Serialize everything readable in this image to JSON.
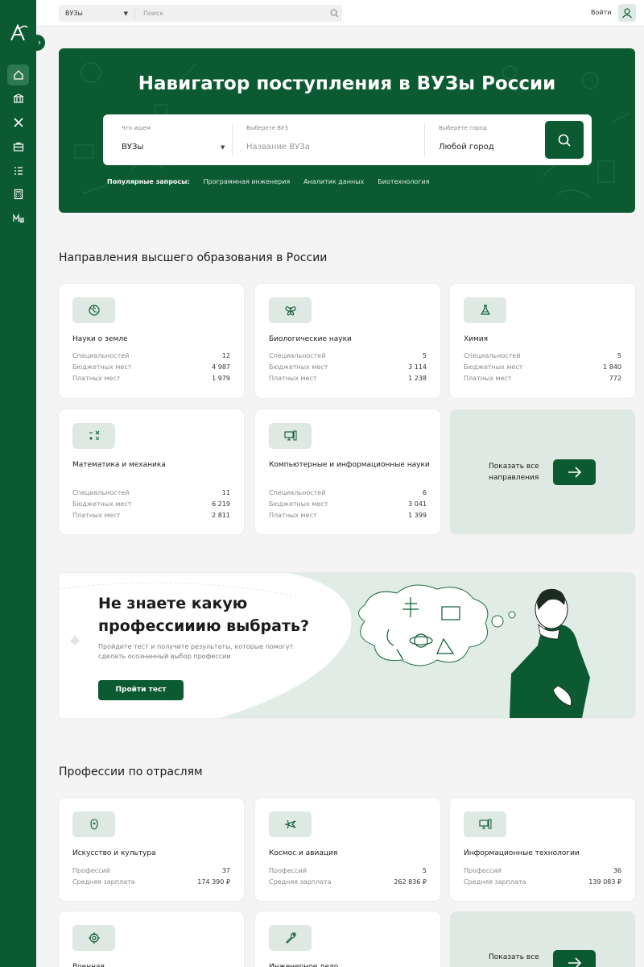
{
  "topbar": {
    "search_select": "ВУЗы",
    "search_placeholder": "Поиск",
    "login": "Войти"
  },
  "hero": {
    "title": "Навигатор поступления в ВУЗы России",
    "what_label": "Что ищем",
    "what_value": "ВУЗы",
    "vuz_label": "Выберете ВУЗ",
    "vuz_placeholder": "Название ВУЗа",
    "city_label": "Выберете город",
    "city_value": "Любой город",
    "popular_label": "Популярные запросы:",
    "popular_items": [
      "Программная инженерия",
      "Аналитик данных",
      "Биотехнология"
    ]
  },
  "directions": {
    "title": "Направления высшего образования в России",
    "stat_labels": [
      "Специальностей",
      "Бюджетных мест",
      "Платных мест"
    ],
    "cards": [
      {
        "name": "Науки о земле",
        "icon": "globe-icon",
        "values": [
          "12",
          "4 987",
          "1 979"
        ]
      },
      {
        "name": "Биологические науки",
        "icon": "butterfly-icon",
        "values": [
          "5",
          "3 114",
          "1 238"
        ]
      },
      {
        "name": "Химия",
        "icon": "flask-icon",
        "values": [
          "5",
          "1 840",
          "772"
        ]
      },
      {
        "name": "Математика и механика",
        "icon": "math-icon",
        "values": [
          "11",
          "6 219",
          "2 811"
        ]
      },
      {
        "name": "Компьютерные и информационные науки",
        "icon": "computer-icon",
        "values": [
          "6",
          "3 041",
          "1 399"
        ]
      }
    ],
    "show_all": "Показать все направления"
  },
  "banner": {
    "title": "Не знаете какую профессииию выбрать?",
    "text": "Пройдите тест и получите результаты, которые помогут сделать осознанный выбор профессии",
    "button": "Пройти тест"
  },
  "professions": {
    "title": "Профессии по отраслям",
    "stat_labels": [
      "Профессий",
      "Средняя зарплата"
    ],
    "cards": [
      {
        "name": "Искусство и культура",
        "icon": "art-icon",
        "values": [
          "37",
          "174 390 ₽"
        ]
      },
      {
        "name": "Космос и авиация",
        "icon": "plane-icon",
        "values": [
          "5",
          "262 836 ₽"
        ]
      },
      {
        "name": "Информационные технологии",
        "icon": "computer-icon",
        "values": [
          "36",
          "139 083 ₽"
        ]
      },
      {
        "name": "Военная",
        "icon": "target-icon",
        "values": []
      },
      {
        "name": "Инженерное дело",
        "icon": "wrench-icon",
        "values": []
      }
    ],
    "show_all": "Показать все"
  },
  "colors": {
    "brand": "#0b5a31",
    "brand_light": "#dfe9e3",
    "background": "#f4f4f4"
  }
}
